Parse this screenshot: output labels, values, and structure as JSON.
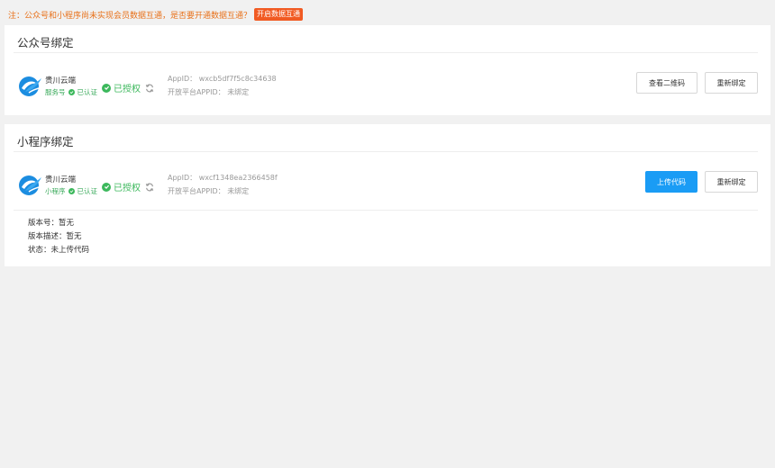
{
  "notice": {
    "text": "注：公众号和小程序尚未实现会员数据互通，是否要开通数据互通？",
    "button_label": "开启数据互通"
  },
  "colors": {
    "notice_text": "#e8711a",
    "notice_button": "#f15a22",
    "authorized_green": "#3cb85c",
    "primary_button": "#1a9cf5"
  },
  "official_account": {
    "title": "公众号绑定",
    "name": "贵川云端",
    "type": "服务号",
    "certified": "已认证",
    "auth_status": "已授权",
    "appid_label": "AppID：",
    "appid_value": "wxcb5df7f5c8c34638",
    "open_platform_label": "开放平台APPID：",
    "open_platform_value": "未绑定",
    "qrcode_button": "查看二维码",
    "rebind_button": "重新绑定"
  },
  "mini_program": {
    "title": "小程序绑定",
    "name": "贵川云端",
    "type": "小程序",
    "certified": "已认证",
    "auth_status": "已授权",
    "appid_label": "AppID：",
    "appid_value": "wxcf1348ea2366458f",
    "open_platform_label": "开放平台APPID：",
    "open_platform_value": "未绑定",
    "upload_button": "上传代码",
    "rebind_button": "重新绑定",
    "version_label": "版本号：",
    "version_value": "暂无",
    "description_label": "版本描述：",
    "description_value": "暂无",
    "status_label": "状态：",
    "status_value": "未上传代码"
  }
}
